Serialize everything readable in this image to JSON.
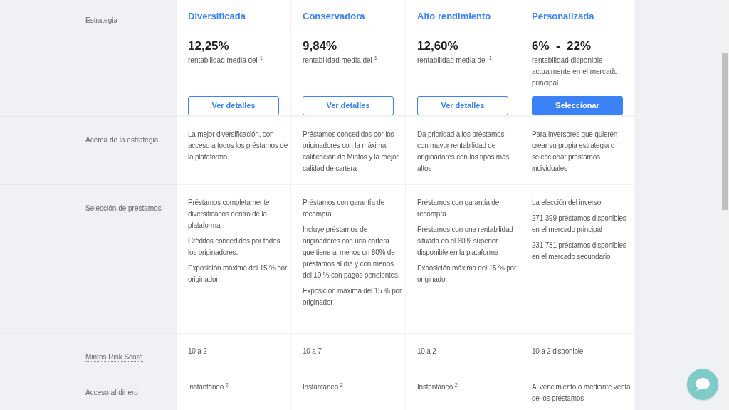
{
  "strategies": [
    {
      "name": "Diversificada",
      "rate": "12,25%",
      "rate_note": "rentabilidad media del $^{1}$",
      "button": {
        "label": "Ver detalles",
        "kind": "outline"
      }
    },
    {
      "name": "Conservadora",
      "rate": "9,84%",
      "rate_note": "rentabilidad media del $^{1}$",
      "button": {
        "label": "Ver detalles",
        "kind": "outline"
      }
    },
    {
      "name": "Alto rendimiento",
      "rate": "12,60%",
      "rate_note": "rentabilidad media del $^{1}$",
      "button": {
        "label": "Ver detalles",
        "kind": "outline"
      }
    },
    {
      "name": "Personalizada",
      "rate": "6%  -  22%",
      "rate_note": "rentabilidad disponible actualmente en el mercado principal",
      "button": {
        "label": "Seleccionar",
        "kind": "primary"
      }
    }
  ],
  "header_label": "Estrategia",
  "rows": [
    {
      "label": "Acerca de la estrategia",
      "underlined": false,
      "cells": [
        {
          "paragraphs": [
            "La mejor diversificación, con acceso a todos los préstamos de la plataforma."
          ]
        },
        {
          "paragraphs": [
            "Préstamos concedidos por los originadores con la máxima calificación de Mintos y la mejor calidad de cartera"
          ]
        },
        {
          "paragraphs": [
            "Da prioridad a los préstamos con mayor rentabilidad de originadores con los tipos más altos"
          ]
        },
        {
          "paragraphs": [
            "Para inversores que quieren crear su propia estrategia o seleccionar préstamos individuales"
          ]
        }
      ]
    },
    {
      "label": "Selección de préstamos",
      "underlined": false,
      "cells": [
        {
          "paragraphs": [
            "Préstamos completamente diversificados dentro de la plataforma.",
            "Créditos concedidos por todos los originadores.",
            "Exposición máxima del 15 % por originador"
          ]
        },
        {
          "paragraphs": [
            "Préstamos con garantía de recompra",
            "Incluye préstamos de originadores con una cartera que tiene al menos un 80% de préstamos al día y con menos del 10 % con pagos pendientes.",
            "Exposición máxima del 15 % por originador"
          ]
        },
        {
          "paragraphs": [
            "Préstamos con garantía de recompra",
            "Préstamos con una rentabilidad situada en el 60% superior disponible en la plataforma",
            "Exposición máxima del 15 % por originador"
          ]
        },
        {
          "paragraphs": [
            "La elección del inversor",
            "271 399 préstamos disponibles en el mercado principal",
            "231 731 préstamos disponibles en el mercado secundario"
          ]
        }
      ]
    },
    {
      "label": "Mintos Risk Score",
      "underlined": true,
      "cells": [
        {
          "paragraphs": [
            "10 a 2"
          ]
        },
        {
          "paragraphs": [
            "10 a 7"
          ]
        },
        {
          "paragraphs": [
            "10 a 2"
          ]
        },
        {
          "paragraphs": [
            "10 a 2 disponible"
          ]
        }
      ]
    },
    {
      "label": "Acceso al dinero",
      "underlined": false,
      "cells": [
        {
          "paragraphs": [
            "Instantáneo $^{2}$"
          ]
        },
        {
          "paragraphs": [
            "Instantáneo $^{2}$"
          ]
        },
        {
          "paragraphs": [
            "Instantáneo $^{2}$"
          ]
        },
        {
          "paragraphs": [
            "Al vencimiento o mediante venta de los préstamos"
          ]
        }
      ]
    }
  ]
}
